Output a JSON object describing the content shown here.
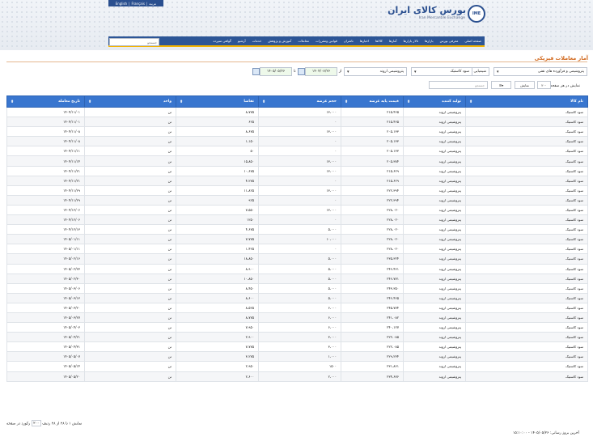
{
  "header": {
    "lang_links": [
      "English",
      "Français",
      "عربية"
    ],
    "logo_fa": "بورس کالای ایران",
    "logo_en": "Iran Mercantile Exchange",
    "logo_mark": "IME"
  },
  "nav": {
    "items": [
      "صفحه اصلی",
      "معرفی بورس",
      "بازارها",
      "تالار بازارها",
      "آمارها",
      "کالاها",
      "اخبارها",
      "ناشران",
      "قوانین ومقررات",
      "معاملات",
      "آموزش و پژوهش",
      "خدمات",
      "آرشیو",
      "گواهی سپرده"
    ],
    "search_placeholder": "جستجو"
  },
  "page": {
    "title": "آمار معاملات فیزیکی"
  },
  "filters": {
    "group": "پتروشیمی و فرآورده های نفتی",
    "subgroup": "شیمیایی",
    "commodity": "سود کاستیک",
    "producer": "پتروشیمی اروند",
    "from_label": "از",
    "to_label": "تا",
    "from_date": "۱۴۰۴/۰۷/۲۶",
    "to_date": "۱۴۰۵/۰۵/۲۶"
  },
  "controls": {
    "page_size_label": "نمایش در هر صفحه",
    "page_size": "۲۰۰",
    "show_button": "نمایش",
    "search_placeholder": "جستجو"
  },
  "table": {
    "headers": [
      "نام کالا",
      "تولید کننده",
      "قیمت پایه عرضه",
      "حجم عرضه",
      "تقاضا",
      "واحد",
      "تاریخ معامله"
    ],
    "rows": [
      [
        "سود کاستیک",
        "پتروشیمی اروند",
        "۲۱۵،۴۶۵",
        "۱۳،۰۰۰",
        "۸،۷۷۵",
        "تن",
        "۱۴۰۴/۱۱/۰۱"
      ],
      [
        "سود کاستیک",
        "پتروشیمی اروند",
        "۲۱۵،۴۶۵",
        "۰",
        "۶۲۵",
        "تن",
        "۱۴۰۴/۱۱/۰۱"
      ],
      [
        "سود کاستیک",
        "پتروشیمی اروند",
        "۲۰۵،۱۳۳",
        "۱۳،۰۰۰",
        "۸،۶۷۵",
        "تن",
        "۱۴۰۴/۱۱/۰۸"
      ],
      [
        "سود کاستیک",
        "پتروشیمی اروند",
        "۲۰۵،۱۳۳",
        "۰",
        "۱،۱۵۰",
        "تن",
        "۱۴۰۴/۱۱/۰۸"
      ],
      [
        "سود کاستیک",
        "پتروشیمی اروند",
        "۲۰۵،۱۳۳",
        "۰",
        "۵۰",
        "تن",
        "۱۴۰۴/۱۱/۱۱"
      ],
      [
        "سود کاستیک",
        "پتروشیمی اروند",
        "۲۰۵،۳۸۴",
        "۱۳،۰۰۰",
        "۱۵،۸۵۰",
        "تن",
        "۱۴۰۴/۱۱/۱۴"
      ],
      [
        "سود کاستیک",
        "پتروشیمی اروند",
        "۲۱۵،۶۲۹",
        "۱۳،۰۰۰",
        "۱۰،۶۷۵",
        "تن",
        "۱۴۰۴/۱۱/۲۱"
      ],
      [
        "سود کاستیک",
        "پتروشیمی اروند",
        "۲۱۵،۶۲۹",
        "۰",
        "۴،۲۷۵",
        "تن",
        "۱۴۰۴/۱۱/۲۱"
      ],
      [
        "سود کاستیک",
        "پتروشیمی اروند",
        "۲۲۲،۳۹۴",
        "۱۳،۰۰۰",
        "۱۱،۸۲۵",
        "تن",
        "۱۴۰۴/۱۱/۲۹"
      ],
      [
        "سود کاستیک",
        "پتروشیمی اروند",
        "۲۲۲،۳۹۴",
        "۰",
        "۹۲۵",
        "تن",
        "۱۴۰۴/۱۱/۲۹"
      ],
      [
        "سود کاستیک",
        "پتروشیمی اروند",
        "۲۲۸،۰۲۰",
        "۱۳،۰۰۰",
        "۷،۵۵۰",
        "تن",
        "۱۴۰۴/۱۲/۰۶"
      ],
      [
        "سود کاستیک",
        "پتروشیمی اروند",
        "۲۲۸،۰۲۰",
        "۰",
        "۱۲۵۰",
        "تن",
        "۱۴۰۴/۱۲/۰۶"
      ],
      [
        "سود کاستیک",
        "پتروشیمی اروند",
        "۲۲۸،۰۲۰",
        "۵،۰۰۰",
        "۴،۶۷۵",
        "تن",
        "۱۴۰۴/۱۲/۱۳"
      ],
      [
        "سود کاستیک",
        "پتروشیمی اروند",
        "۲۲۸،۰۲۰",
        "۱۰،۰۰۰",
        "۷،۷۷۵",
        "تن",
        "۱۴۰۵/۰۱/۱۱"
      ],
      [
        "سود کاستیک",
        "پتروشیمی اروند",
        "۲۲۸،۰۲۰",
        "۰",
        "۱،۴۲۵",
        "تن",
        "۱۴۰۵/۰۱/۱۱"
      ],
      [
        "سود کاستیک",
        "پتروشیمی اروند",
        "۲۳۵،۳۲۴",
        "۵،۰۰۰",
        "۱۸،۸۵۰",
        "تن",
        "۱۴۰۵/۰۲/۱۶"
      ],
      [
        "سود کاستیک",
        "پتروشیمی اروند",
        "۲۴۶،۴۶۱",
        "۵،۰۰۰",
        "۸،۹۰۰",
        "تن",
        "۱۴۰۵/۰۲/۲۳"
      ],
      [
        "سود کاستیک",
        "پتروشیمی اروند",
        "۲۴۶،۷۷۱",
        "۵،۰۰۰",
        "۱۰،۸۵۰",
        "تن",
        "۱۴۰۵/۰۲/۳۰"
      ],
      [
        "سود کاستیک",
        "پتروشیمی اروند",
        "۲۴۳،۳۵۰",
        "۵،۰۰۰",
        "۸،۴۵۰",
        "تن",
        "۱۴۰۵/۰۳/۰۶"
      ],
      [
        "سود کاستیک",
        "پتروشیمی اروند",
        "۲۴۶،۴۶۵",
        "۵،۰۰۰",
        "۸،۶۰۰",
        "تن",
        "۱۴۰۵/۰۳/۱۳"
      ],
      [
        "سود کاستیک",
        "پتروشیمی اروند",
        "۲۴۵،۷۷۴",
        "۶،۰۰۰",
        "۸،۵۲۵",
        "تن",
        "۱۴۰۵/۰۳/۲۰"
      ],
      [
        "سود کاستیک",
        "پتروشیمی اروند",
        "۲۴۱،۰۸۲",
        "۶،۰۰۰",
        "۸،۷۷۵",
        "تن",
        "۱۴۰۵/۰۳/۲۷"
      ],
      [
        "سود کاستیک",
        "پتروشیمی اروند",
        "۲۴۰،۱۲۷",
        "۶،۰۰۰",
        "۷،۹۵۰",
        "تن",
        "۱۴۰۵/۰۴/۰۳"
      ],
      [
        "سود کاستیک",
        "پتروشیمی اروند",
        "۲۲۲،۰۸۵",
        "۳،۰۰۰",
        "۲،۹۰۰",
        "تن",
        "۱۴۰۵/۰۴/۲۱"
      ],
      [
        "سود کاستیک",
        "پتروشیمی اروند",
        "۲۲۲،۰۸۵",
        "۳،۰۰۰",
        "۷،۷۷۵",
        "تن",
        "۱۴۰۵/۰۴/۳۱"
      ],
      [
        "سود کاستیک",
        "پتروشیمی اروند",
        "۲۲۹،۲۳۴",
        "۱،۰۰۰",
        "۳،۲۷۵",
        "تن",
        "۱۴۰۵/۰۵/۰۷"
      ],
      [
        "سود کاستیک",
        "پتروشیمی اروند",
        "۲۳۱،۸۶۱",
        "۱۵۰۰",
        "۲،۹۵۰",
        "تن",
        "۱۴۰۵/۰۵/۱۴"
      ],
      [
        "سود کاستیک",
        "پتروشیمی اروند",
        "۲۳۴،۶۷۶",
        "۲،۰۰۰",
        "۲،۶۰۰",
        "تن",
        "۱۴۰۵/۰۵/۲۰"
      ]
    ]
  },
  "footer": {
    "pagination_text": "نمایش ۱ تا ۲۸ از ۲۸ ردیف",
    "rows_select": "۲۰۰",
    "rows_suffix": "رکورد در صفحه",
    "last_update": "آخرین بروز رسانی: ۱۴۰۵/۰۵/۲۶ - ۱۵:۱۰:۰۰"
  }
}
